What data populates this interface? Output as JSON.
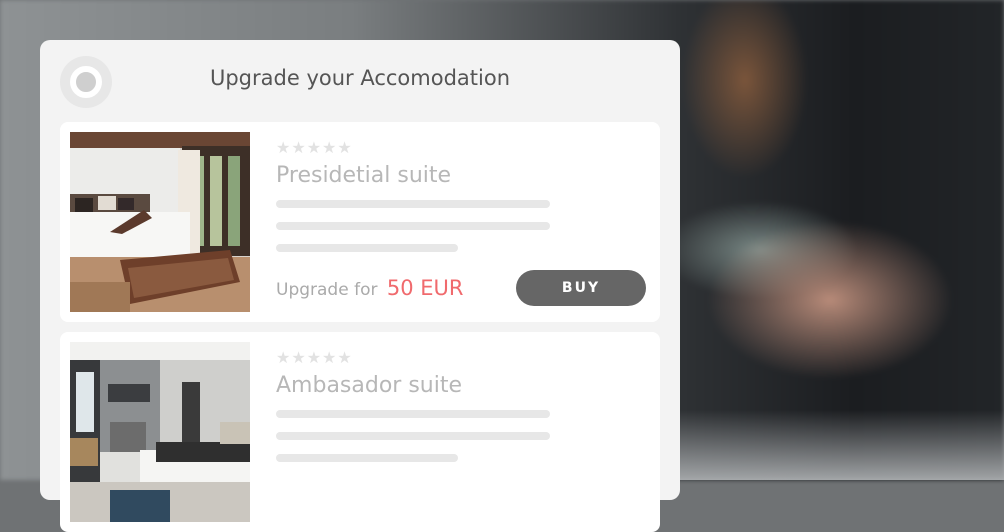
{
  "dialog": {
    "title": "Upgrade your Accomodation"
  },
  "rooms": [
    {
      "name": "Presidetial suite",
      "stars": "★★★★★",
      "price_prefix": "Upgrade for",
      "price": "50 EUR",
      "buy_label": "BUY"
    },
    {
      "name": "Ambasador suite",
      "stars": "★★★★★"
    }
  ],
  "colors": {
    "price_accent": "#f06a6d",
    "button_bg": "#666666",
    "panel_bg": "#f3f3f3"
  },
  "icons": {
    "logo": "logo-icon",
    "rating": "star-icon"
  }
}
